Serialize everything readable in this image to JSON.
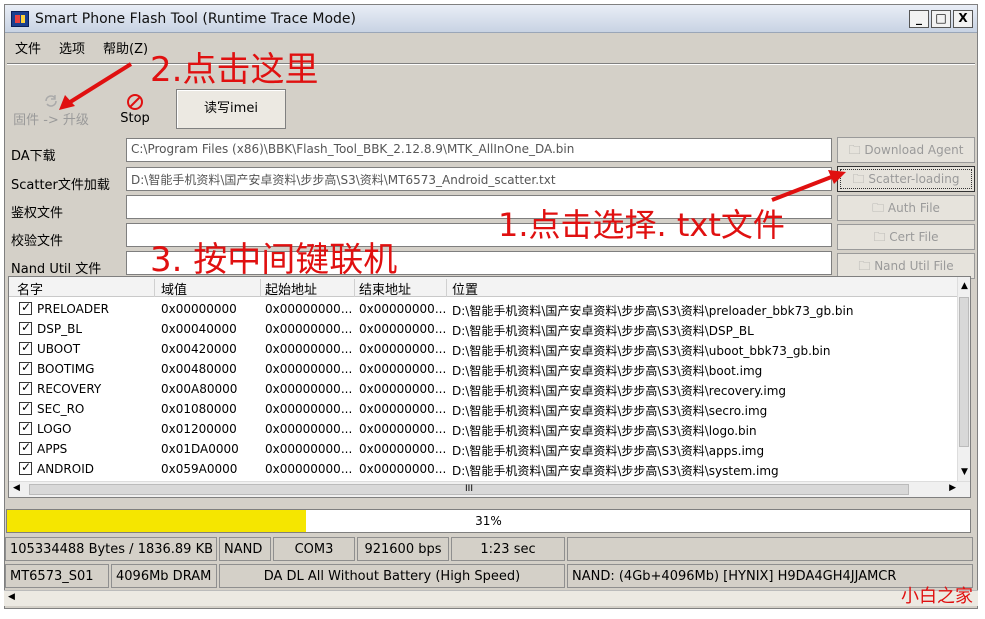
{
  "window": {
    "title": "Smart Phone Flash Tool (Runtime Trace Mode)",
    "controls": [
      "_",
      "□",
      "X"
    ]
  },
  "menu": [
    "文件",
    "选项",
    "帮助(Z)"
  ],
  "toolbar": {
    "firmware_upgrade_label": "固件 -> 升级",
    "stop_label": "Stop",
    "read_imei_label": "读写imei"
  },
  "fields": [
    {
      "label": "DA下载",
      "value": "C:\\Program Files (x86)\\BBK\\Flash_Tool_BBK_2.12.8.9\\MTK_AllInOne_DA.bin"
    },
    {
      "label": "Scatter文件加载",
      "value": "D:\\智能手机资料\\国产安卓资料\\步步高\\S3\\资料\\MT6573_Android_scatter.txt"
    },
    {
      "label": "鉴权文件",
      "value": ""
    },
    {
      "label": "校验文件",
      "value": ""
    },
    {
      "label": "Nand Util 文件",
      "value": ""
    }
  ],
  "side_buttons": [
    "Download Agent",
    "Scatter-loading",
    "Auth File",
    "Cert File",
    "Nand Util File"
  ],
  "table": {
    "headers": [
      "名字",
      "域值",
      "起始地址",
      "结束地址",
      "位置"
    ],
    "rows": [
      {
        "name": "PRELOADER",
        "value": "0x00000000",
        "start": "0x00000000...",
        "end": "0x00000000...",
        "path": "D:\\智能手机资料\\国产安卓资料\\步步高\\S3\\资料\\preloader_bbk73_gb.bin"
      },
      {
        "name": "DSP_BL",
        "value": "0x00040000",
        "start": "0x00000000...",
        "end": "0x00000000...",
        "path": "D:\\智能手机资料\\国产安卓资料\\步步高\\S3\\资料\\DSP_BL"
      },
      {
        "name": "UBOOT",
        "value": "0x00420000",
        "start": "0x00000000...",
        "end": "0x00000000...",
        "path": "D:\\智能手机资料\\国产安卓资料\\步步高\\S3\\资料\\uboot_bbk73_gb.bin"
      },
      {
        "name": "BOOTIMG",
        "value": "0x00480000",
        "start": "0x00000000...",
        "end": "0x00000000...",
        "path": "D:\\智能手机资料\\国产安卓资料\\步步高\\S3\\资料\\boot.img"
      },
      {
        "name": "RECOVERY",
        "value": "0x00A80000",
        "start": "0x00000000...",
        "end": "0x00000000...",
        "path": "D:\\智能手机资料\\国产安卓资料\\步步高\\S3\\资料\\recovery.img"
      },
      {
        "name": "SEC_RO",
        "value": "0x01080000",
        "start": "0x00000000...",
        "end": "0x00000000...",
        "path": "D:\\智能手机资料\\国产安卓资料\\步步高\\S3\\资料\\secro.img"
      },
      {
        "name": "LOGO",
        "value": "0x01200000",
        "start": "0x00000000...",
        "end": "0x00000000...",
        "path": "D:\\智能手机资料\\国产安卓资料\\步步高\\S3\\资料\\logo.bin"
      },
      {
        "name": "APPS",
        "value": "0x01DA0000",
        "start": "0x00000000...",
        "end": "0x00000000...",
        "path": "D:\\智能手机资料\\国产安卓资料\\步步高\\S3\\资料\\apps.img"
      },
      {
        "name": "ANDROID",
        "value": "0x059A0000",
        "start": "0x00000000...",
        "end": "0x00000000...",
        "path": "D:\\智能手机资料\\国产安卓资料\\步步高\\S3\\资料\\system.img"
      }
    ],
    "hscroll_grip": "III"
  },
  "progress": {
    "percent": 31,
    "label": "31%",
    "color": "#f5e600"
  },
  "status_row1": [
    "105334488 Bytes / 1836.89 KB",
    "NAND",
    "COM3",
    "921600 bps",
    "1:23 sec",
    ""
  ],
  "status_row2": [
    "MT6573_S01",
    "4096Mb DRAM",
    "DA DL All Without Battery (High Speed)",
    "NAND: (4Gb+4096Mb) [HYNIX] H9DA4GH4JJAMCR"
  ],
  "annotations": {
    "step2": "2.点击这里",
    "step1": "1.点击选择. txt文件",
    "step3": "3. 按中间键联机",
    "color": "#e01010"
  },
  "watermark": "小白之家"
}
